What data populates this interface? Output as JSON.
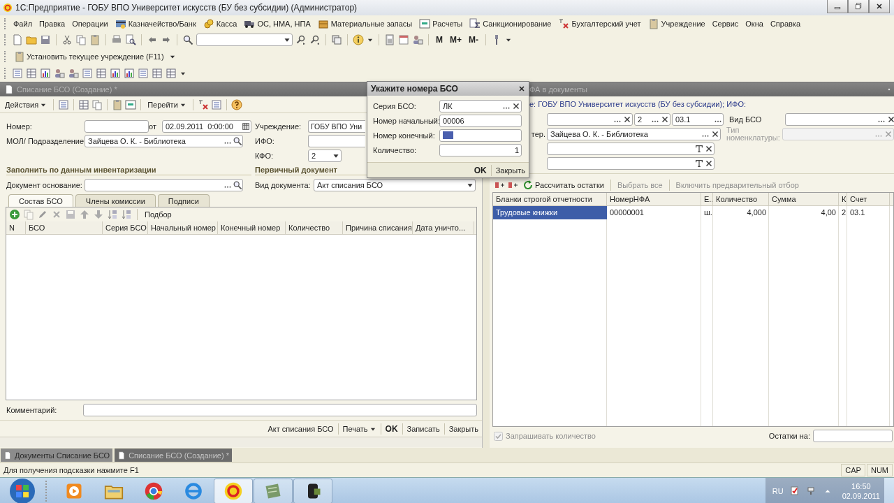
{
  "window": {
    "title": "1С:Предприятие - ГОБУ ВПО Университет искусств (БУ без субсидии) (Администратор)"
  },
  "menu": [
    "Файл",
    "Правка",
    "Операции",
    "Казначейство/Банк",
    "Касса",
    "ОС, НМА, НПА",
    "Материальные запасы",
    "Расчеты",
    "Санкционирование",
    "Бухгалтерский учет",
    "Учреждение",
    "Сервис",
    "Окна",
    "Справка"
  ],
  "toolbar": {
    "memory_buttons": [
      "M",
      "M+",
      "M-"
    ],
    "set_institution": "Установить текущее учреждение (F11)"
  },
  "doc_form": {
    "title": "Списание БСО (Создание) *",
    "actions": [
      "Действия",
      "Перейти"
    ],
    "number_label": "Номер:",
    "date_label": "от",
    "date_value": "02.09.2011  0:00:00",
    "mol_label": "МОЛ/ Подразделение:",
    "mol_value": "Зайцева О. К. - Библиотека",
    "institution_label": "Учреждение:",
    "institution_value": "ГОБУ ВПО Уни",
    "ifo_label": "ИФО:",
    "kfo_label": "КФО:",
    "kfo_value": "2",
    "inventory_section": "Заполнить по данным инвентаризации",
    "base_doc_label": "Документ основание:",
    "primary_section": "Первичный документ",
    "doc_type_label": "Вид документа:",
    "doc_type_value": "Акт списания БСО",
    "tabs": [
      {
        "label": "Состав БСО",
        "selected": true
      },
      {
        "label": "Члены комиссии",
        "selected": false
      },
      {
        "label": "Подписи",
        "selected": false
      }
    ],
    "table_action": "Подбор",
    "columns": [
      "N",
      "БСО",
      "Серия БСО",
      "Начальный номер",
      "Конечный номер",
      "Количество",
      "Причина списания",
      "Дата уничто..."
    ],
    "comment_label": "Комментарий:",
    "footer_buttons": [
      {
        "label": "Акт списания БСО",
        "kind": "plain"
      },
      {
        "label": "Печать",
        "kind": "menu"
      },
      {
        "label": "OK",
        "kind": "default"
      },
      {
        "label": "Записать",
        "kind": "plain"
      },
      {
        "label": "Закрыть",
        "kind": "plain"
      }
    ]
  },
  "bso_dialog": {
    "title": "Укажите номера БСО",
    "fields": [
      {
        "label": "Серия БСО:",
        "value": "ЛК",
        "kind": "choice"
      },
      {
        "label": "Номер начальный:",
        "value": "00006",
        "kind": "text"
      },
      {
        "label": "Номер конечный:",
        "kind": "selected"
      },
      {
        "label": "Количество:",
        "value": "1",
        "kind": "number"
      }
    ],
    "buttons": [
      {
        "label": "OK",
        "kind": "default"
      },
      {
        "label": "Закрыть",
        "kind": "plain"
      }
    ]
  },
  "nfa_form": {
    "title": "ФА в документы",
    "filter_caption": "е: ГОБУ ВПО Университет искусств (БУ без субсидии); ИФО:",
    "kfo_value": "2",
    "account_value": "03.1",
    "bso_kind_label": "Вид БСО",
    "mol_label": "тер.",
    "mol_value": "Зайцева О. К. - Библиотека",
    "nomenclature_label": "Тип номенклатуры:",
    "nomenclature_disabled": true,
    "actions": [
      {
        "label": "Рассчитать остатки",
        "disabled": false
      },
      {
        "label": "Выбрать все",
        "disabled": true
      },
      {
        "label": "Включить предварительный отбор",
        "disabled": true
      }
    ],
    "columns": [
      "Бланки строгой отчетности",
      "НомерНФА",
      "Е..",
      "Количество",
      "Сумма",
      "К",
      "Счет"
    ],
    "rows": [
      {
        "cells": [
          "Трудовые книжки",
          "00000001",
          "ш.",
          "4,000",
          "4,00",
          "2",
          "03.1"
        ],
        "selected": true
      }
    ],
    "ask_quantity": {
      "label": "Запрашивать количество",
      "checked": true,
      "disabled": true
    },
    "balance_label": "Остатки на:"
  },
  "window_tabs": [
    {
      "label": "Документы Списание БСО",
      "selected": false
    },
    {
      "label": "Списание БСО (Создание) *",
      "selected": true
    }
  ],
  "status_bar": {
    "hint": "Для получения подсказки нажмите F1",
    "indicators": [
      "CAP",
      "NUM"
    ]
  },
  "taskbar": {
    "apps": [
      {
        "running": false,
        "active": false
      },
      {
        "running": false,
        "active": false
      },
      {
        "running": false,
        "active": false
      },
      {
        "running": false,
        "active": false
      },
      {
        "running": true,
        "active": true
      },
      {
        "running": true,
        "active": false
      },
      {
        "running": true,
        "active": false
      }
    ],
    "language": "RU",
    "time": "16:50",
    "date": "02.09.2011"
  }
}
